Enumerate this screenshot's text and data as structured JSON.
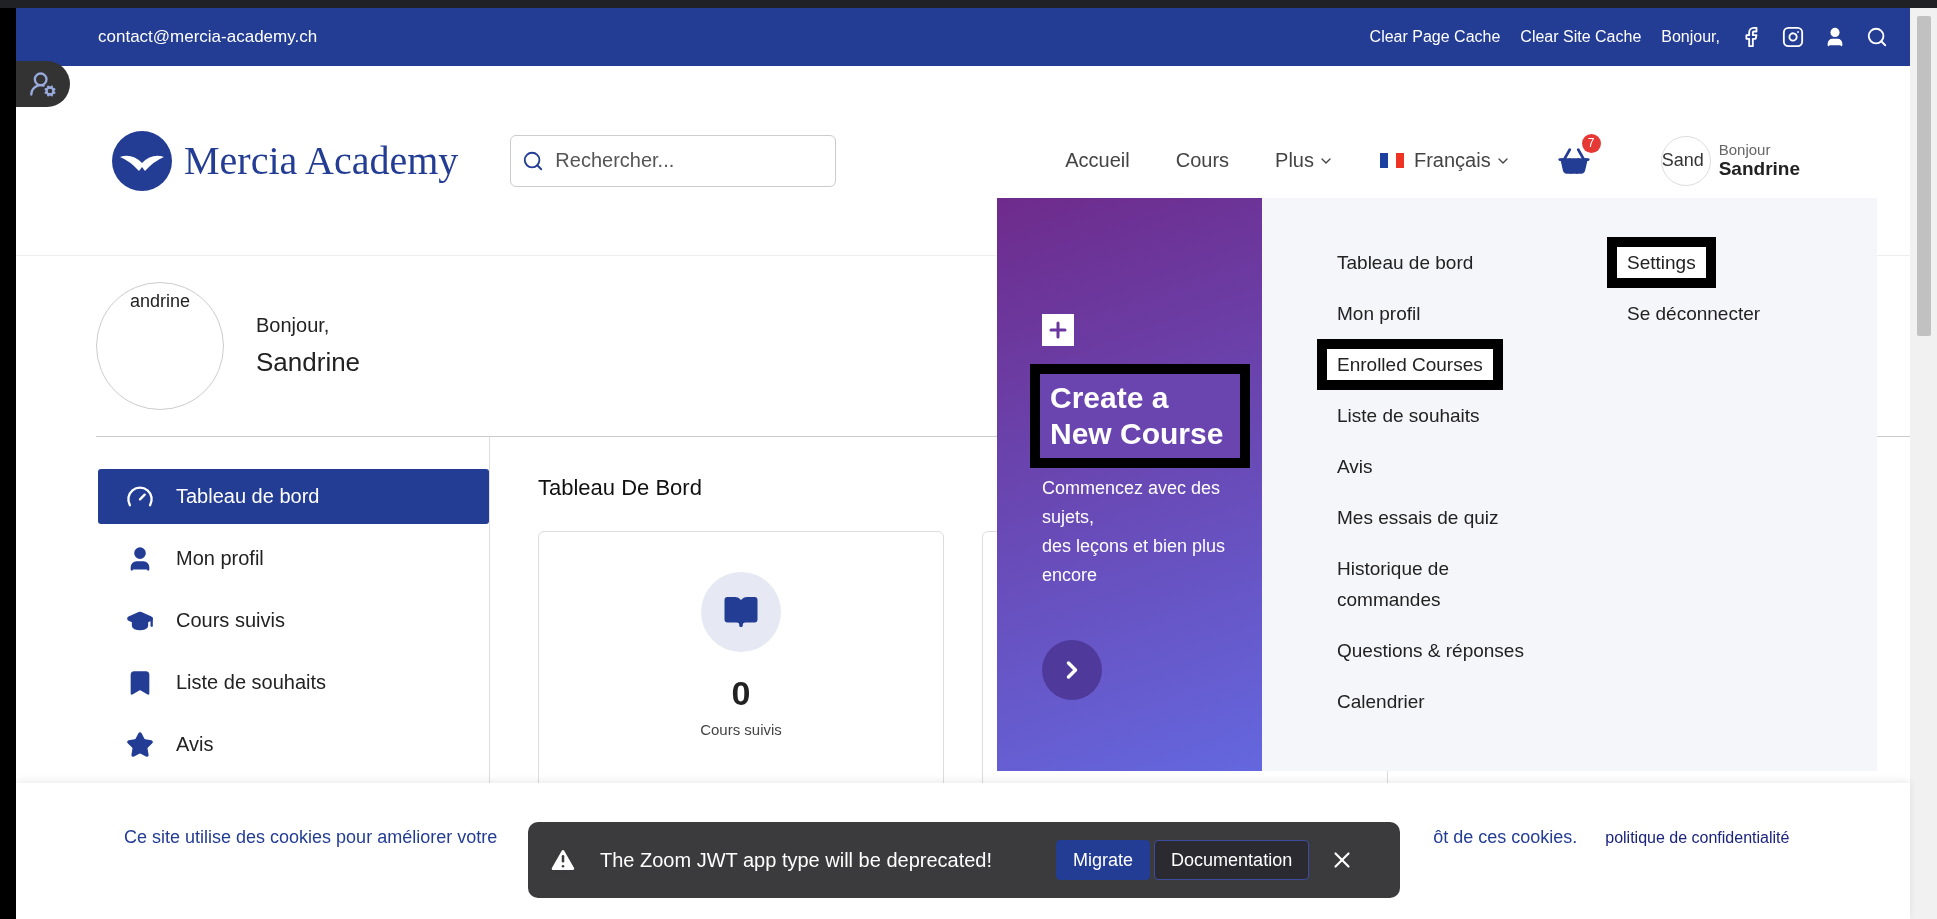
{
  "top_bar": {
    "email": "contact@mercia-academy.ch",
    "links": [
      "Clear Page Cache",
      "Clear Site Cache",
      "Bonjour,"
    ]
  },
  "header": {
    "logo": "Mercia Academy",
    "search": {
      "placeholder": "Rechercher..."
    },
    "nav": [
      {
        "label": "Accueil",
        "dropdown": false
      },
      {
        "label": "Cours",
        "dropdown": false
      },
      {
        "label": "Plus",
        "dropdown": true
      }
    ],
    "language": {
      "label": "Français",
      "dropdown": true
    },
    "cart_count": "7",
    "user": {
      "avatar_text": "Sand",
      "greeting": "Bonjour",
      "name": "Sandrine"
    }
  },
  "profile": {
    "avatar_text": "andrine",
    "greeting": "Bonjour,",
    "name": "Sandrine"
  },
  "sidebar": {
    "items": [
      {
        "label": "Tableau de bord",
        "selected": true
      },
      {
        "label": "Mon profil",
        "selected": false
      },
      {
        "label": "Cours suivis",
        "selected": false
      },
      {
        "label": "Liste de souhaits",
        "selected": false
      },
      {
        "label": "Avis",
        "selected": false
      }
    ]
  },
  "dashboard": {
    "title": "Tableau De Bord",
    "cards": [
      {
        "value": "0",
        "label": "Cours suivis"
      }
    ]
  },
  "user_menu": {
    "promo": {
      "title": "Create a New Course",
      "highlighted": true,
      "lines": [
        "Commencez avec des sujets,",
        "des leçons et bien plus encore"
      ]
    },
    "columns": [
      [
        {
          "label": "Tableau de bord",
          "highlighted": false
        },
        {
          "label": "Mon profil",
          "highlighted": false
        },
        {
          "label": "Enrolled Courses",
          "highlighted": true
        },
        {
          "label": "Liste de souhaits",
          "highlighted": false
        },
        {
          "label": "Avis",
          "highlighted": false
        },
        {
          "label": "Mes essais de quiz",
          "highlighted": false
        },
        {
          "label": "Historique de commandes",
          "highlighted": false
        },
        {
          "label": "Questions & réponses",
          "highlighted": false
        },
        {
          "label": "Calendrier",
          "highlighted": false
        }
      ],
      [
        {
          "label": "Settings",
          "highlighted": true
        },
        {
          "label": "Se déconnecter",
          "highlighted": false
        }
      ]
    ]
  },
  "cookie_notice": {
    "text_start": "Ce site utilise des cookies pour améliorer votre",
    "text_end": "ôt de ces cookies.",
    "link": "politique de confidentialité"
  },
  "toast": {
    "message": "The Zoom JWT app type will be deprecated!",
    "buttons": [
      {
        "label": "Migrate",
        "primary": true
      },
      {
        "label": "Documentation",
        "primary": false
      }
    ]
  }
}
